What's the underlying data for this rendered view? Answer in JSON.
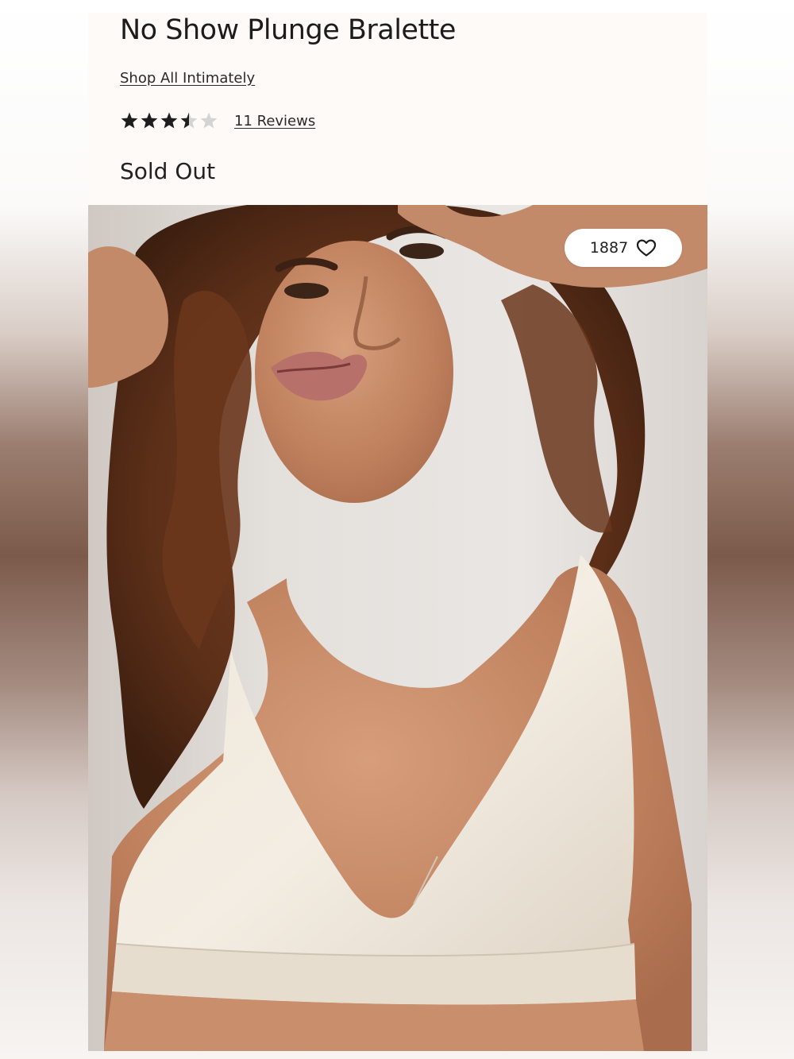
{
  "product": {
    "title": "No Show Plunge Bralette",
    "shop_link": "Shop All Intimately",
    "rating": {
      "value": 3.5,
      "max": 5,
      "reviews_label": "11 Reviews"
    },
    "availability": "Sold Out"
  },
  "image": {
    "like_count": "1887",
    "like_icon": "heart-outline-icon"
  },
  "colors": {
    "star_filled": "#1e1e1e",
    "star_empty": "#d4d4d4",
    "text": "#1c1c1c",
    "card_background": "#fdfaf8"
  }
}
